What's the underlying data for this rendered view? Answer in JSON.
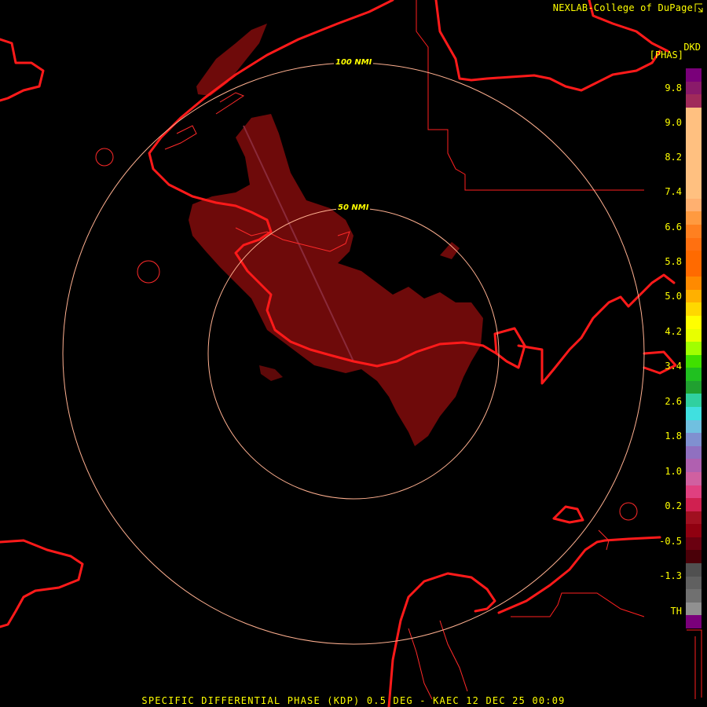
{
  "header": {
    "credit": "NEXLAB-College of DuPage",
    "product_code": "DKD",
    "units": "[PHAS]"
  },
  "rings": {
    "inner_label": "50 NMI",
    "outer_label": "100 NMI"
  },
  "legend": {
    "ticks": [
      "9.8",
      "9.0",
      "8.2",
      "7.4",
      "6.6",
      "5.8",
      "5.0",
      "4.2",
      "3.4",
      "2.6",
      "1.8",
      "1.0",
      "0.2",
      "-0.5",
      "-1.3",
      "TH"
    ]
  },
  "footer": {
    "caption": "SPECIFIC DIFFERENTIAL PHASE (KDP) 0.5 DEG - KAEC 12 DEC 25 00:09"
  },
  "colors": {
    "background": "#000000",
    "echo": "#7a0a0a",
    "coastline": "#ff1a1a",
    "range_ring": "#ffb090",
    "text": "#ffff00"
  },
  "colorbar_swatches": [
    "#7a007a",
    "#8a1a6a",
    "#a02a5a",
    "#ffc080",
    "#ffc080",
    "#ffc080",
    "#ffc080",
    "#ffc080",
    "#ffc080",
    "#ffc080",
    "#ffb070",
    "#ff9a40",
    "#ff8020",
    "#ff7010",
    "#ff6a00",
    "#ff6a00",
    "#ff8a00",
    "#ffb000",
    "#ffd800",
    "#ffff00",
    "#e8ff00",
    "#a0ff00",
    "#40e000",
    "#20c020",
    "#20a030",
    "#30d0a0",
    "#40e0e0",
    "#70c0e0",
    "#8090d0",
    "#9070c0",
    "#b060b0",
    "#d060a0",
    "#e04080",
    "#d02050",
    "#a01020",
    "#900010",
    "#6a0010",
    "#4a0008",
    "#505050",
    "#606060",
    "#707070",
    "#909090",
    "#7a007a"
  ]
}
